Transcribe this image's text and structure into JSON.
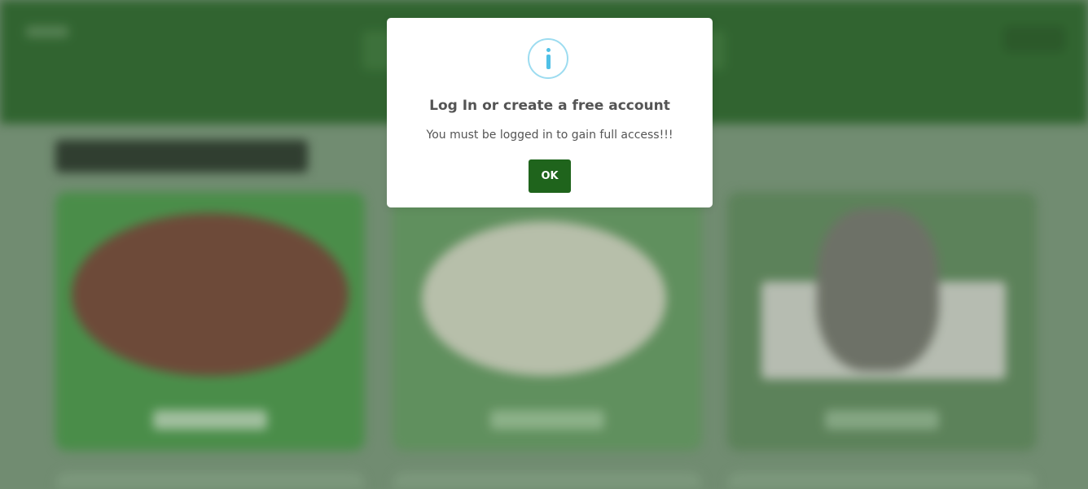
{
  "modal": {
    "icon": "info-icon",
    "title": "Log In or create a free account",
    "message": "You must be logged in to gain full access!!!",
    "ok_label": "OK"
  },
  "colors": {
    "header": "#205a1f",
    "ok_button": "#1f641c",
    "info_icon": "#4fc0e6",
    "text": "#545454"
  }
}
